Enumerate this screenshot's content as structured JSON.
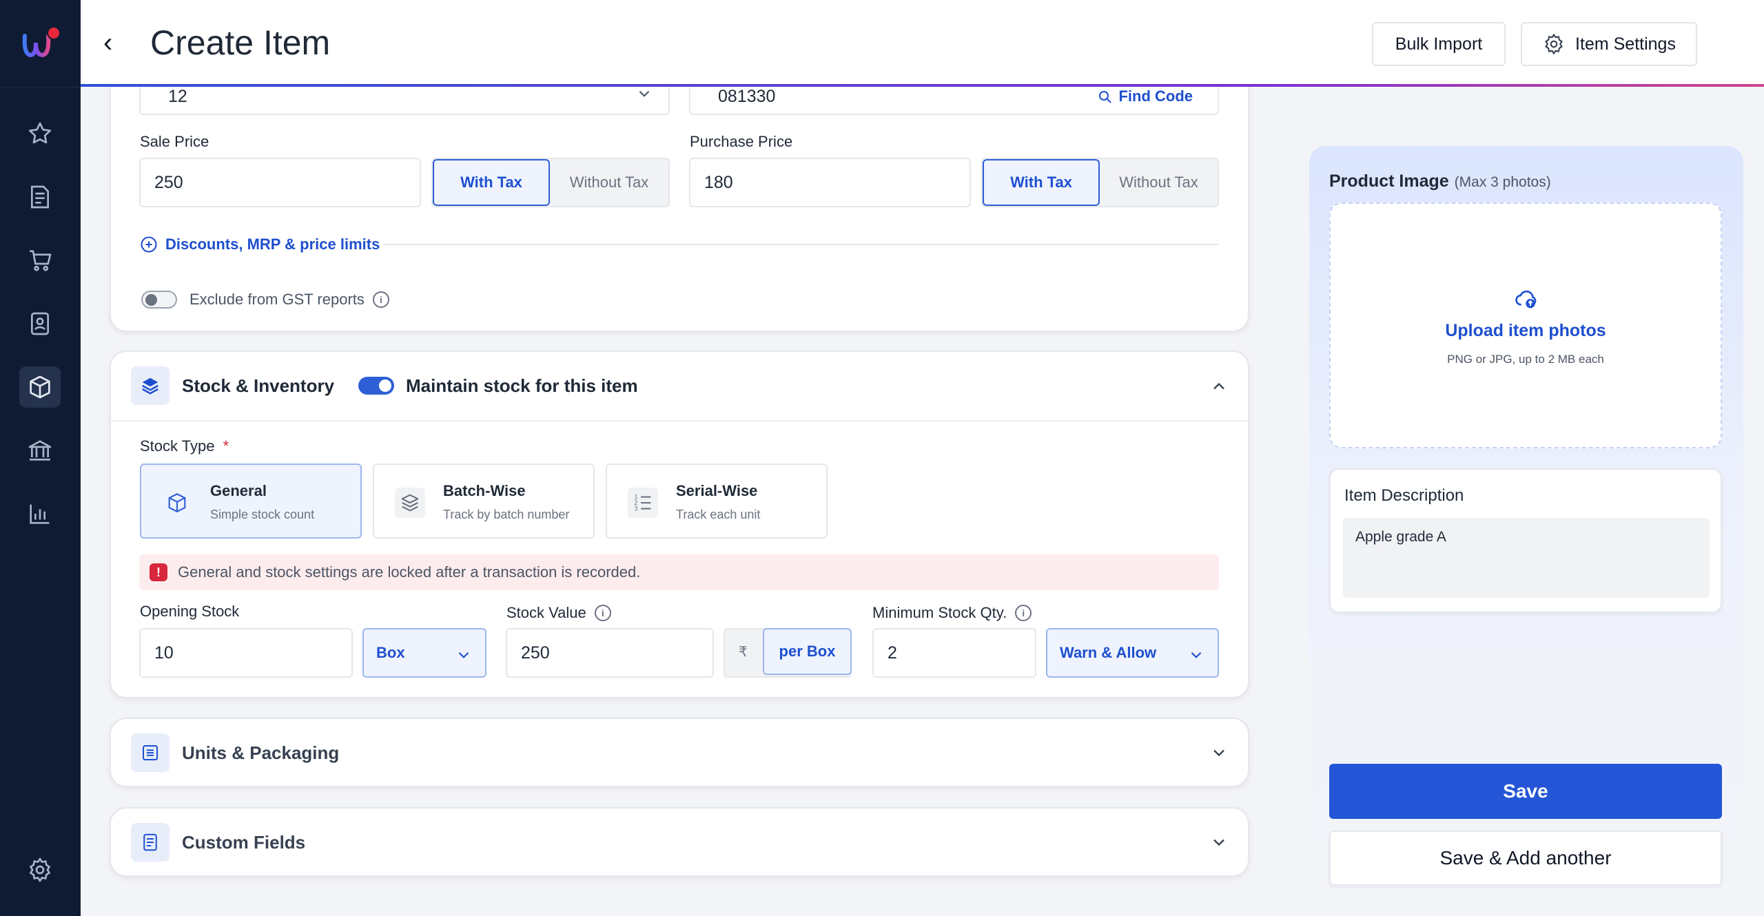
{
  "header": {
    "title": "Create Item",
    "back_glyph": "‹",
    "bulk_import_label": "Bulk Import",
    "item_settings_label": "Item Settings"
  },
  "sidebar": {
    "items": [
      {
        "name": "favorites",
        "icon": "star-icon"
      },
      {
        "name": "invoices",
        "icon": "document-icon"
      },
      {
        "name": "purchases",
        "icon": "cart-icon"
      },
      {
        "name": "contacts",
        "icon": "contact-book-icon"
      },
      {
        "name": "items",
        "icon": "box-icon",
        "active": true
      },
      {
        "name": "banking",
        "icon": "bank-icon"
      },
      {
        "name": "reports",
        "icon": "bar-chart-icon"
      },
      {
        "name": "settings",
        "icon": "gear-icon"
      }
    ]
  },
  "pricing": {
    "partial_unit_value": "12",
    "partial_code_value": "081330",
    "find_code_label": "Find Code",
    "sale_price_label": "Sale Price",
    "sale_price_value": "250",
    "purchase_price_label": "Purchase Price",
    "purchase_price_value": "180",
    "with_tax_label": "With Tax",
    "without_tax_label": "Without Tax",
    "discounts_link": "Discounts, MRP & price limits",
    "exclude_gst_label": "Exclude from GST reports"
  },
  "stock": {
    "section_title": "Stock & Inventory",
    "maintain_stock_label": "Maintain stock for this item",
    "stock_type_label": "Stock Type",
    "required_mark": "*",
    "types": [
      {
        "title": "General",
        "subtitle": "Simple stock count"
      },
      {
        "title": "Batch-Wise",
        "subtitle": "Track by batch number"
      },
      {
        "title": "Serial-Wise",
        "subtitle": "Track each unit"
      }
    ],
    "lock_notice": "General and stock settings are locked after a transaction is recorded.",
    "opening_stock_label": "Opening Stock",
    "opening_stock_value": "10",
    "unit_value": "Box",
    "stock_value_label": "Stock Value",
    "stock_value_value": "250",
    "currency_symbol": "₹",
    "per_unit_label": "per Box",
    "min_stock_label": "Minimum Stock Qty.",
    "min_stock_value": "2",
    "min_stock_action": "Warn & Allow"
  },
  "sections": {
    "units_title": "Units & Packaging",
    "custom_fields_title": "Custom Fields"
  },
  "product_image": {
    "title": "Product Image",
    "hint": "(Max 3 photos)",
    "upload_label": "Upload item photos",
    "upload_hint": "PNG or JPG, up to 2 MB each"
  },
  "description": {
    "title": "Item Description",
    "value": "Apple grade A"
  },
  "actions": {
    "save_label": "Save",
    "save_add_label": "Save & Add another"
  },
  "colors": {
    "sidebar_bg": "#0f1b33",
    "accent": "#2355d6",
    "link": "#1e4fcf",
    "alert_bg": "#fdecee",
    "alert_icon": "#d7263d"
  }
}
